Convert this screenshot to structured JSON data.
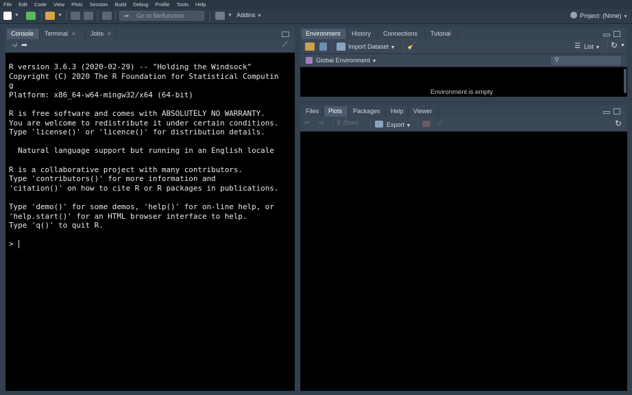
{
  "menu": [
    "File",
    "Edit",
    "Code",
    "View",
    "Plots",
    "Session",
    "Build",
    "Debug",
    "Profile",
    "Tools",
    "Help"
  ],
  "toolbar": {
    "goto_placeholder": "Go to file/function",
    "addins_label": "Addins",
    "project_label": "Project: (None)"
  },
  "console": {
    "tabs": [
      {
        "label": "Console"
      },
      {
        "label": "Terminal"
      },
      {
        "label": "Jobs"
      }
    ],
    "path": "~/",
    "output": "R version 3.6.3 (2020-02-29) -- \"Holding the Windsock\"\nCopyright (C) 2020 The R Foundation for Statistical Computin\ng\nPlatform: x86_64-w64-mingw32/x64 (64-bit)\n\nR is free software and comes with ABSOLUTELY NO WARRANTY.\nYou are welcome to redistribute it under certain conditions.\nType 'license()' or 'licence()' for distribution details.\n\n  Natural language support but running in an English locale\n\nR is a collaborative project with many contributors.\nType 'contributors()' for more information and\n'citation()' on how to cite R or R packages in publications.\n\nType 'demo()' for some demos, 'help()' for on-line help, or\n'help.start()' for an HTML browser interface to help.\nType 'q()' to quit R.",
    "prompt": ">"
  },
  "env": {
    "tabs": [
      {
        "label": "Environment"
      },
      {
        "label": "History"
      },
      {
        "label": "Connections"
      },
      {
        "label": "Tutorial"
      }
    ],
    "import_label": "Import Dataset",
    "list_label": "List",
    "scope_label": "Global Environment",
    "empty_message": "Environment is empty"
  },
  "files": {
    "tabs": [
      {
        "label": "Files"
      },
      {
        "label": "Plots"
      },
      {
        "label": "Packages"
      },
      {
        "label": "Help"
      },
      {
        "label": "Viewer"
      }
    ],
    "zoom_label": "Zoom",
    "export_label": "Export"
  }
}
